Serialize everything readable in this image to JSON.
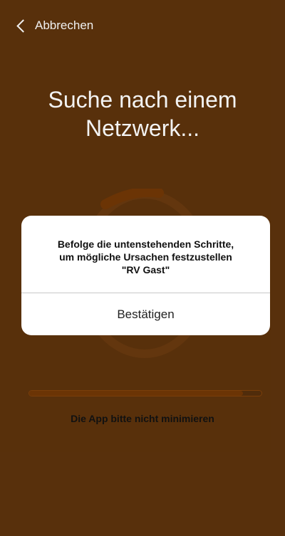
{
  "nav": {
    "back_label": "Abbrechen"
  },
  "main": {
    "title_line1": "Suche nach einem",
    "title_line2": "Netzwerk...",
    "progress_fraction": 0.92,
    "hint": "Die App bitte nicht minimieren"
  },
  "dialog": {
    "line1": "Befolge die untenstehenden Schritte,",
    "line2": "um mögliche Ursachen festzustellen",
    "line3": "\"RV Gast\"",
    "confirm_label": "Bestätigen"
  },
  "colors": {
    "background": "#e87f1f",
    "progress_fill": "#6b3405",
    "spinner_arc": "#6b3405"
  },
  "icons": {
    "back": "chevron-left-icon"
  }
}
